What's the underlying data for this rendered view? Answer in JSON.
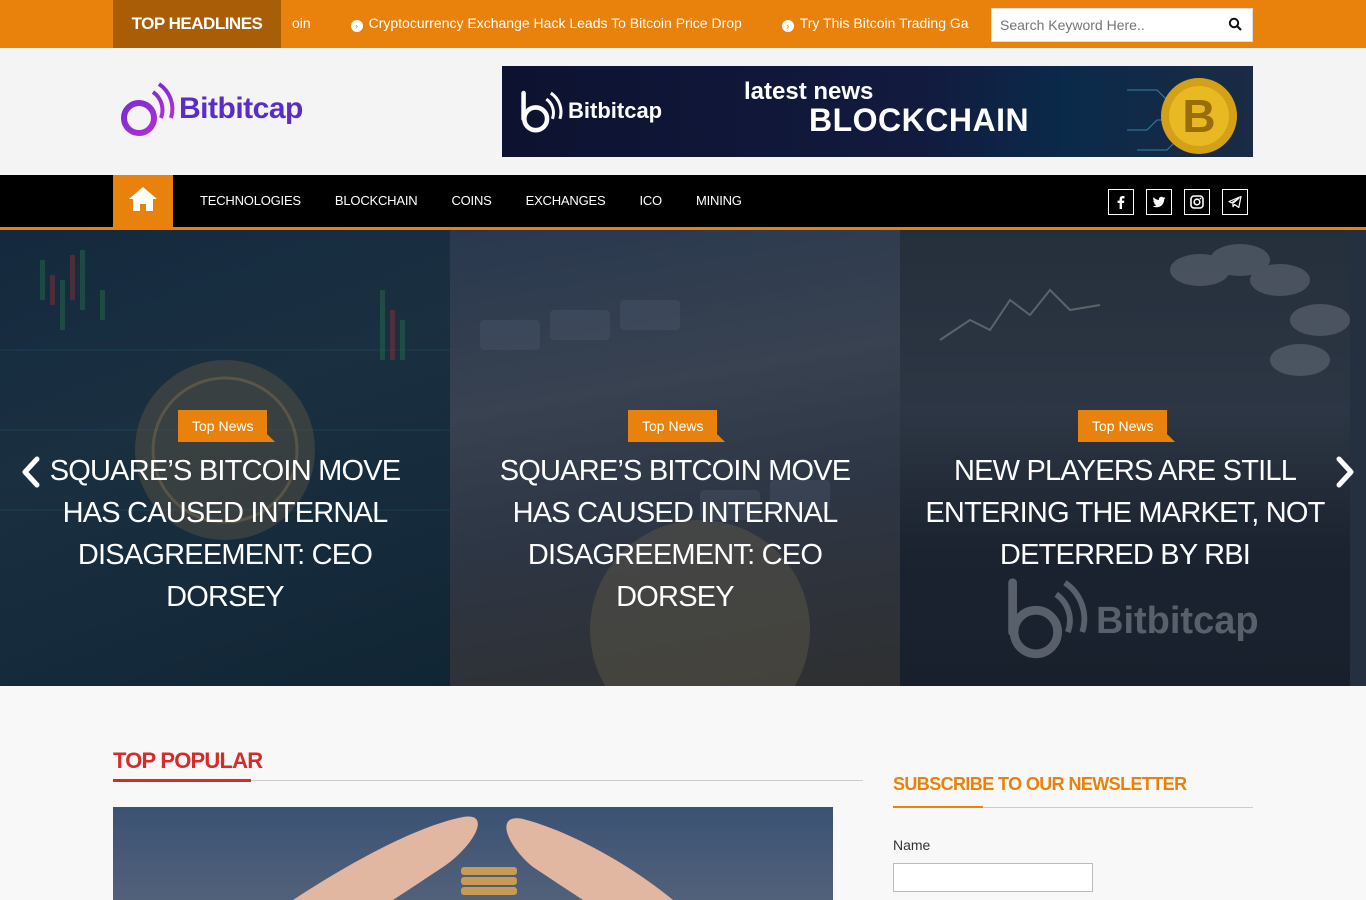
{
  "topbar": {
    "label": "TOP HEADLINES",
    "ticker": [
      "Cryptocurrency Exchange Hack Leads To Bitcoin Price Drop",
      "Try This Bitcoin Trading Ga"
    ],
    "ticker_partial": "oin",
    "search_placeholder": "Search Keyword Here.."
  },
  "header": {
    "logo_text": "Bitbitcap",
    "banner": {
      "logo_text": "Bitbitcap",
      "line1": "latest news",
      "line2": "BLOCKCHAIN"
    }
  },
  "nav": {
    "items": [
      "TECHNOLOGIES",
      "BLOCKCHAIN",
      "COINS",
      "EXCHANGES",
      "ICO",
      "MINING"
    ],
    "social_icons": [
      "facebook-icon",
      "twitter-icon",
      "instagram-icon",
      "telegram-icon"
    ]
  },
  "slider": {
    "slides": [
      {
        "tag": "Top News",
        "title": "SQUARE’S BITCOIN MOVE HAS CAUSED INTERNAL DISAGREEMENT: CEO DORSEY"
      },
      {
        "tag": "Top News",
        "title": "SQUARE’S BITCOIN MOVE HAS CAUSED INTERNAL DISAGREEMENT: CEO DORSEY"
      },
      {
        "tag": "Top News",
        "title": "NEW PLAYERS ARE STILL ENTERING THE MARKET, NOT DETERRED BY RBI"
      }
    ],
    "watermark_text": "Bitbitcap"
  },
  "main": {
    "section_title": "TOP POPULAR"
  },
  "newsletter": {
    "title": "SUBSCRIBE TO OUR NEWSLETTER",
    "name_label": "Name"
  },
  "colors": {
    "accent": "#e8820c",
    "accent_dark": "#a85d06",
    "brand_purple": "#5b2dc4",
    "section_red": "#d62b2b",
    "nav_bg": "#000000"
  }
}
